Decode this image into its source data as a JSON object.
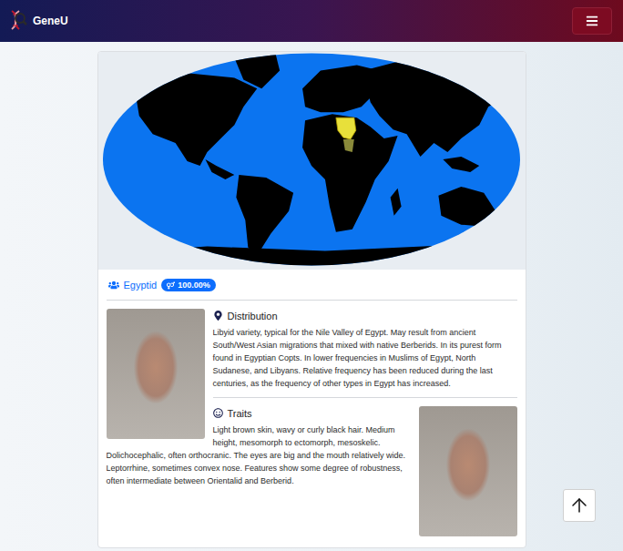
{
  "navbar": {
    "brand": "GeneU"
  },
  "type": {
    "name": "Egyptid",
    "badge": "100.00%"
  },
  "sections": [
    {
      "kind": "photo-left",
      "heading": "Distribution",
      "text": "Libyid variety, typical for the Nile Valley of Egypt. May result from ancient South/West Asian migrations that mixed with native Berberids. In its purest form found in Egyptian Copts. In lower frequencies in Muslims of Egypt, North Sudanese, and Libyans. Relative frequency has been reduced during the last centuries, as the frequency of other types in Egypt has increased."
    },
    {
      "kind": "photo-right",
      "heading": "Traits",
      "text": "Light brown skin, wavy or curly black hair. Medium height, mesomorph to ectomorph, mesoskelic. Dolichocephalic, often orthocranic. The eyes are big and the mouth relatively wide. Leptorrhine, sometimes convex nose. Features show some degree of robustness, often intermediate between Orientalid and Berberid."
    }
  ]
}
